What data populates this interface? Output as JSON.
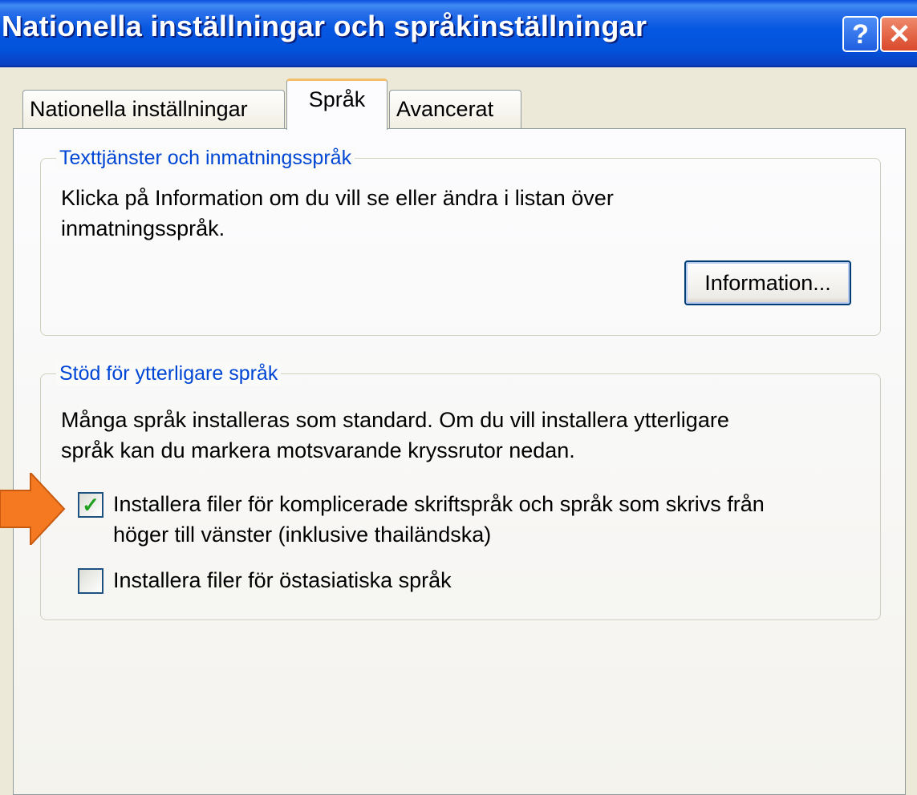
{
  "window": {
    "title": "Nationella inställningar och språkinställningar",
    "help_glyph": "?",
    "close_glyph": "✕",
    "titlebar_color": "#0556e1"
  },
  "tabs": [
    {
      "label": "Nationella inställningar",
      "selected": false
    },
    {
      "label": "Språk",
      "selected": true
    },
    {
      "label": "Avancerat",
      "selected": false
    }
  ],
  "text_services": {
    "legend": "Texttjänster och inmatningsspråk",
    "line1": "Klicka på Information om du vill se eller ändra i listan över",
    "line2": "inmatningsspråk.",
    "button_label": "Information..."
  },
  "extra_languages": {
    "legend": "Stöd för ytterligare språk",
    "line1": "Många språk installeras som standard. Om du vill installera ytterligare",
    "line2": "språk kan du markera motsvarande kryssrutor nedan.",
    "checkboxes": [
      {
        "line1": "Installera filer för komplicerade skriftspråk och språk som skrivs från",
        "line2": "höger till vänster (inklusive thailändska)",
        "checked": true
      },
      {
        "line1": "Installera filer för östasiatiska språk",
        "checked": false
      }
    ]
  },
  "annotation": {
    "arrow_color": "#f47920",
    "check_glyph": "✓"
  }
}
